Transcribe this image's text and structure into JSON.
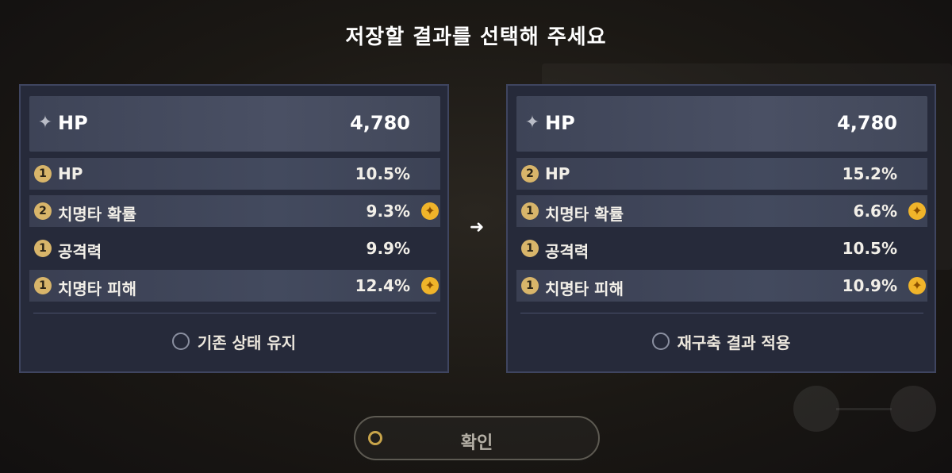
{
  "title": "저장할 결과를 선택해 주세요",
  "cards": [
    {
      "main_stat": {
        "icon": "sparkle-icon",
        "name": "HP",
        "value": "4,780"
      },
      "sub_stats": [
        {
          "rolls": "1",
          "name": "HP",
          "value": "10.5%",
          "plus": false
        },
        {
          "rolls": "2",
          "name": "치명타 확률",
          "value": "9.3%",
          "plus": true
        },
        {
          "rolls": "1",
          "name": "공격력",
          "value": "9.9%",
          "plus": false
        },
        {
          "rolls": "1",
          "name": "치명타 피해",
          "value": "12.4%",
          "plus": true
        }
      ],
      "choice_label": "기존 상태 유지",
      "selected": false
    },
    {
      "main_stat": {
        "icon": "sparkle-icon",
        "name": "HP",
        "value": "4,780"
      },
      "sub_stats": [
        {
          "rolls": "2",
          "name": "HP",
          "value": "15.2%",
          "plus": false
        },
        {
          "rolls": "1",
          "name": "치명타 확률",
          "value": "6.6%",
          "plus": true
        },
        {
          "rolls": "1",
          "name": "공격력",
          "value": "10.5%",
          "plus": false
        },
        {
          "rolls": "1",
          "name": "치명타 피해",
          "value": "10.9%",
          "plus": true
        }
      ],
      "choice_label": "재구축 결과 적용",
      "selected": false
    }
  ],
  "arrow_icon": "arrow-right-icon",
  "confirm_label": "확인",
  "colors": {
    "card_bg": "#262a3a",
    "badge": "#d8b56a",
    "plus": "#f0b42a"
  }
}
